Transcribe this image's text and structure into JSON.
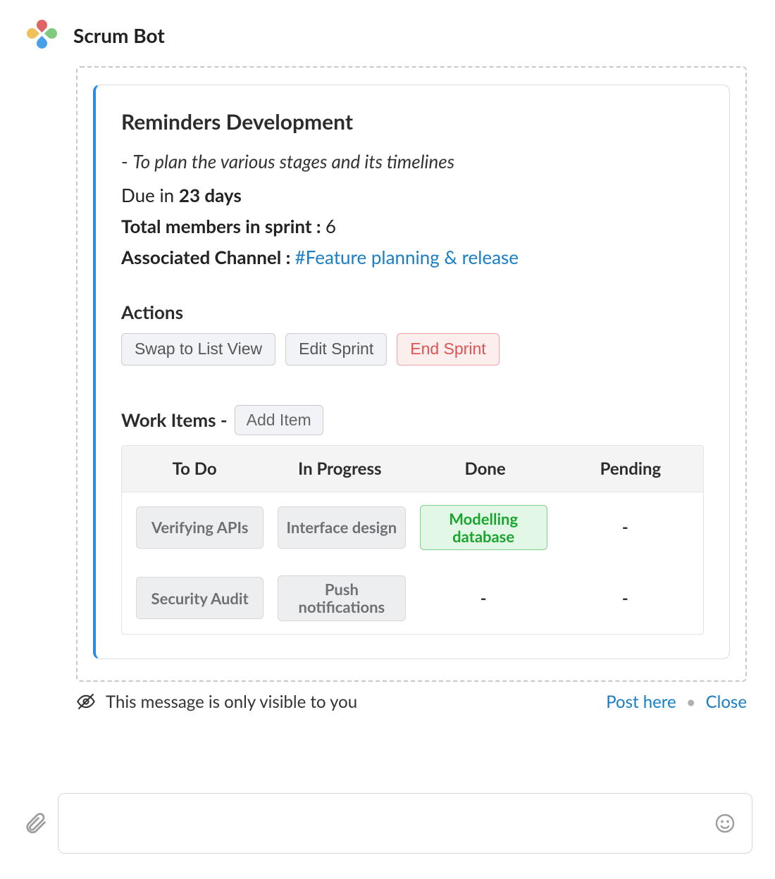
{
  "header": {
    "app_name": "Scrum Bot"
  },
  "sprint": {
    "title": "Reminders Development",
    "goal": "To plan the various stages and its timelines",
    "due_prefix": "Due in ",
    "due_value": "23 days",
    "members_label": "Total members in sprint :  ",
    "members_value": "6",
    "channel_label": "Associated Channel :  ",
    "channel_value": "#Feature planning & release"
  },
  "actions": {
    "section_label": "Actions",
    "swap": "Swap to List View",
    "edit": "Edit Sprint",
    "end": "End Sprint"
  },
  "work_items": {
    "label": "Work Items - ",
    "add_btn": "Add Item",
    "columns": [
      "To Do",
      "In Progress",
      "Done",
      "Pending"
    ],
    "rows": [
      {
        "todo": "Verifying APIs",
        "in_progress": "Interface design",
        "done": "Modelling database",
        "pending": "-"
      },
      {
        "todo": "Security Audit",
        "in_progress": "Push notifications",
        "done": "-",
        "pending": "-"
      }
    ]
  },
  "footer": {
    "visibility_text": "This message is only visible to you",
    "post_here": "Post here",
    "close": "Close"
  }
}
